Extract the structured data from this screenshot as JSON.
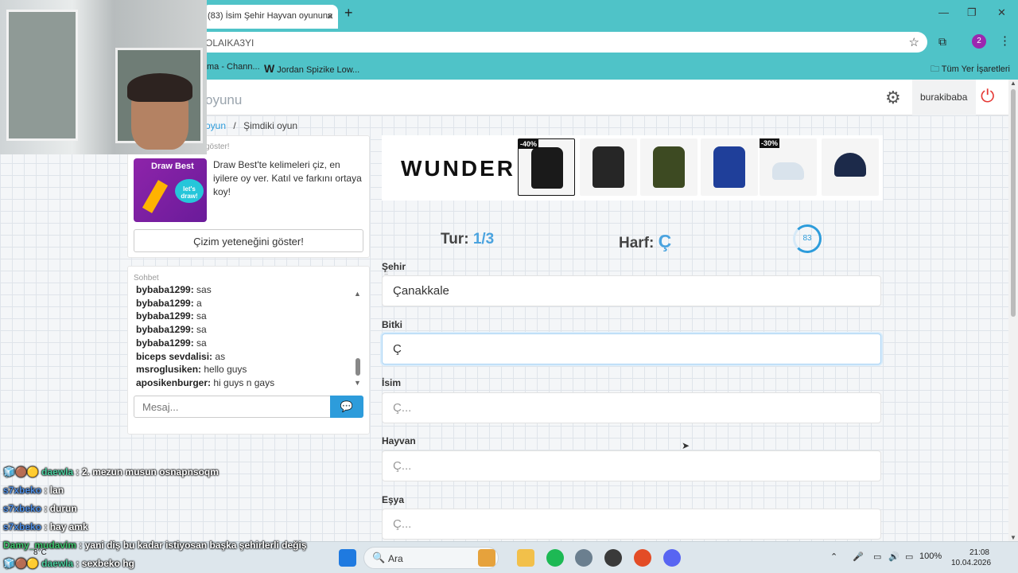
{
  "browser": {
    "tab_title": "(83) İsim Şehir Hayvan oyununa",
    "new_tab": "+",
    "url": "OLAIKA3YI",
    "bookmarks": [
      {
        "label": "ma - Chann..."
      },
      {
        "label": "Jordan Spizike Low..."
      }
    ],
    "all_bookmarks": "Tüm Yer İşaretleri",
    "profile_badge": "2"
  },
  "header": {
    "brand": "oyunu",
    "username": "burakibaba"
  },
  "breadcrumb": {
    "link": "oyun",
    "sep": "/",
    "current": "Şimdiki oyun"
  },
  "sidebar": {
    "ad_header": "göster!",
    "draw_best": {
      "title": "Draw Best",
      "bubble": "let's draw!",
      "desc": "Draw Best'te kelimeleri çiz, en iyilere oy ver. Katıl ve farkını ortaya koy!",
      "button": "Çizim yeteneğini göster!"
    },
    "chat": {
      "title": "Sohbet",
      "messages": [
        {
          "user": "bybaba1299:",
          "text": "sas"
        },
        {
          "user": "bybaba1299:",
          "text": "a"
        },
        {
          "user": "bybaba1299:",
          "text": "sa"
        },
        {
          "user": "bybaba1299:",
          "text": "sa"
        },
        {
          "user": "bybaba1299:",
          "text": "sa"
        },
        {
          "user": "biceps sevdalisi:",
          "text": "as"
        },
        {
          "user": "msroglusiken:",
          "text": "hello guys"
        },
        {
          "user": "aposikenburger:",
          "text": "hi guys n gays"
        }
      ],
      "placeholder": "Mesaj..."
    }
  },
  "ad": {
    "brand": "WUNDER",
    "products": [
      {
        "name": "hoodie-black",
        "badge": "-40%",
        "color": "#1a1a1a"
      },
      {
        "name": "sweatshirt-black",
        "badge": "",
        "color": "#262626"
      },
      {
        "name": "hoodie-olive",
        "badge": "",
        "color": "#3d4a22"
      },
      {
        "name": "zip-hoodie-blue",
        "badge": "",
        "color": "#1f3f9a"
      },
      {
        "name": "sneaker-white",
        "badge": "-30%",
        "color": "#d9e3ec"
      },
      {
        "name": "cap-navy",
        "badge": "",
        "color": "#1c2a4a"
      }
    ]
  },
  "game": {
    "round_label": "Tur:",
    "round_value": "1/3",
    "letter_label": "Harf:",
    "letter_value": "Ç",
    "timer": "83",
    "fields": [
      {
        "label": "Şehir",
        "value": "Çanakkale",
        "placeholder": ""
      },
      {
        "label": "Bitki",
        "value": "Ç",
        "placeholder": ""
      },
      {
        "label": "İsim",
        "value": "",
        "placeholder": "Ç..."
      },
      {
        "label": "Hayvan",
        "value": "",
        "placeholder": "Ç..."
      },
      {
        "label": "Eşya",
        "value": "",
        "placeholder": "Ç..."
      }
    ]
  },
  "stream_chat": [
    {
      "user": "daewla",
      "text": ": 2. mezun musun osnapnsoqm"
    },
    {
      "user": "s7xbeko",
      "text": ": lan"
    },
    {
      "user": "s7xbeko",
      "text": ": durun"
    },
    {
      "user": "s7xbeko",
      "text": ": hay amk"
    },
    {
      "user": "Damy_mudavim",
      "text": ": yani diş bu kadar istiyosan başka şehirlerli değiş"
    },
    {
      "user": "daewla",
      "text": ": sexbeko hg"
    }
  ],
  "taskbar": {
    "weather": "8°C",
    "search": "Ara",
    "lang": "100%",
    "time": "21:08",
    "date": "10.04.2026"
  }
}
